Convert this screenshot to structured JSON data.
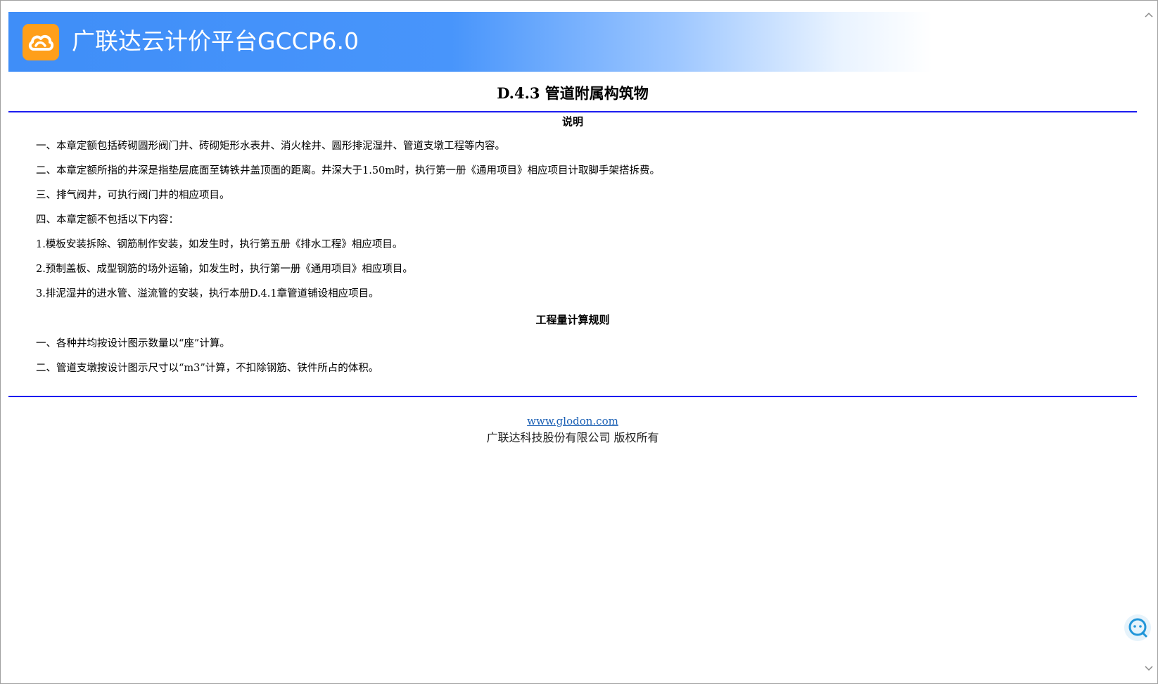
{
  "header": {
    "title": "广联达云计价平台GCCP6.0",
    "logo_icon": "cloud-logo-icon",
    "brand_color": "#3f8ef8",
    "logo_color": "#ff9f1a"
  },
  "document": {
    "title": "D.4.3 管道附属构筑物",
    "sections": [
      {
        "heading": "说明",
        "paragraphs": [
          "一、本章定额包括砖砌圆形阀门井、砖砌矩形水表井、消火栓井、圆形排泥湿井、管道支墩工程等内容。",
          "二、本章定额所指的井深是指垫层底面至铸铁井盖顶面的距离。井深大于1.50m时，执行第一册《通用项目》相应项目计取脚手架搭拆费。",
          "三、排气阀井，可执行阀门井的相应项目。",
          "四、本章定额不包括以下内容：",
          "1.模板安装拆除、钢筋制作安装，如发生时，执行第五册《排水工程》相应项目。",
          "2.预制盖板、成型钢筋的场外运输，如发生时，执行第一册《通用项目》相应项目。",
          "3.排泥湿井的进水管、溢流管的安装，执行本册D.4.1章管道铺设相应项目。"
        ]
      },
      {
        "heading": "工程量计算规则",
        "paragraphs": [
          "一、各种井均按设计图示数量以“座”计算。",
          "二、管道支墩按设计图示尺寸以“m3”计算，不扣除钢筋、铁件所占的体积。"
        ]
      }
    ],
    "rule_color": "#1c1cf0"
  },
  "footer": {
    "link": "www.glodon.com",
    "copyright": "广联达科技股份有限公司 版权所有"
  },
  "widgets": {
    "chat_icon": "chat-bubble-icon",
    "scroll_up_icon": "chevron-up-icon",
    "scroll_down_icon": "chevron-down-icon"
  }
}
